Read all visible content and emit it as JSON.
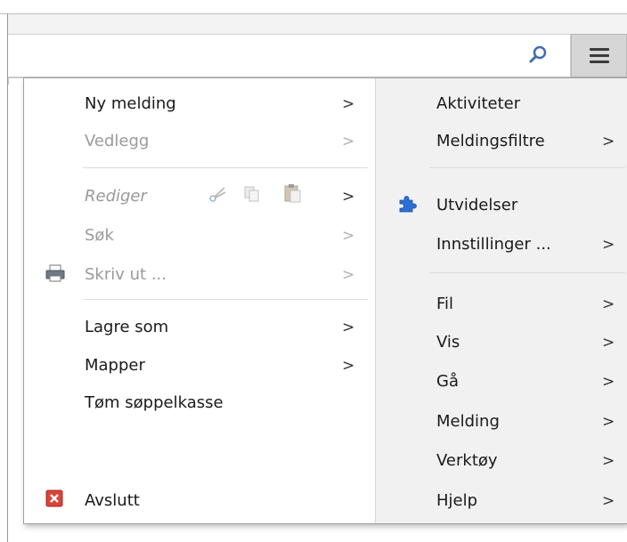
{
  "colors": {
    "menu_button_bg": "#d6d6d6",
    "right_pane_bg": "#f1f1f1",
    "disabled_text": "#9a9a9a",
    "exit_icon_red": "#d9443a",
    "addons_icon_blue": "#2b6fd6"
  },
  "toolbar": {
    "search_icon": "search-icon",
    "menu_icon": "hamburger-menu-icon"
  },
  "left_menu": {
    "new_message": "Ny melding",
    "attachments": "Vedlegg",
    "edit": "Rediger",
    "find": "Søk",
    "print": "Skriv ut ...",
    "save_as": "Lagre som",
    "folders": "Mapper",
    "empty_trash": "Tøm søppelkasse",
    "quit": "Avslutt",
    "arrow": ">"
  },
  "right_menu": {
    "activities": "Aktiviteter",
    "message_filters": "Meldingsfiltre",
    "addons": "Utvidelser",
    "settings": "Innstillinger ...",
    "file": "Fil",
    "view": "Vis",
    "go": "Gå",
    "message": "Melding",
    "tools": "Verktøy",
    "help": "Hjelp",
    "arrow": ">"
  }
}
